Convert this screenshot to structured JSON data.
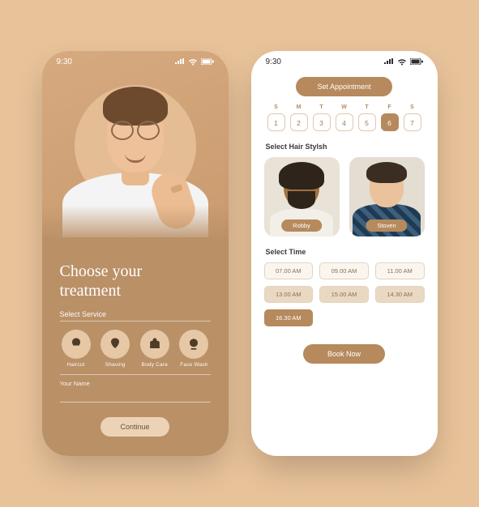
{
  "colors": {
    "accent": "#b68a5c",
    "panel": "#ba9067",
    "bg": "#e8c299"
  },
  "status_time": "9:30",
  "screen1": {
    "title_line1": "Choose your",
    "title_line2": "treatment",
    "select_service_label": "Select Service",
    "services": [
      {
        "key": "haircut",
        "label": "Haircut"
      },
      {
        "key": "shaving",
        "label": "Shaving"
      },
      {
        "key": "bodycare",
        "label": "Body Care"
      },
      {
        "key": "facewash",
        "label": "Face Wash"
      }
    ],
    "name_label": "Your Name",
    "name_value": "",
    "continue_label": "Continue"
  },
  "screen2": {
    "set_appointment_label": "Set Appointment",
    "days_of_week": [
      "S",
      "M",
      "T",
      "W",
      "T",
      "F",
      "S"
    ],
    "dates": [
      1,
      2,
      3,
      4,
      5,
      6,
      7
    ],
    "selected_date": 6,
    "select_stylist_label": "Select Hair Stylsh",
    "stylists": [
      {
        "name": "Robby"
      },
      {
        "name": "Stoven"
      }
    ],
    "select_time_label": "Select Time",
    "times": [
      "07.00 AM",
      "09.00 AM",
      "11.00 AM",
      "13.00 AM",
      "15.00 AM",
      "14.30 AM",
      "16.30 AM"
    ],
    "selected_time": "16.30 AM",
    "book_label": "Book Now"
  }
}
